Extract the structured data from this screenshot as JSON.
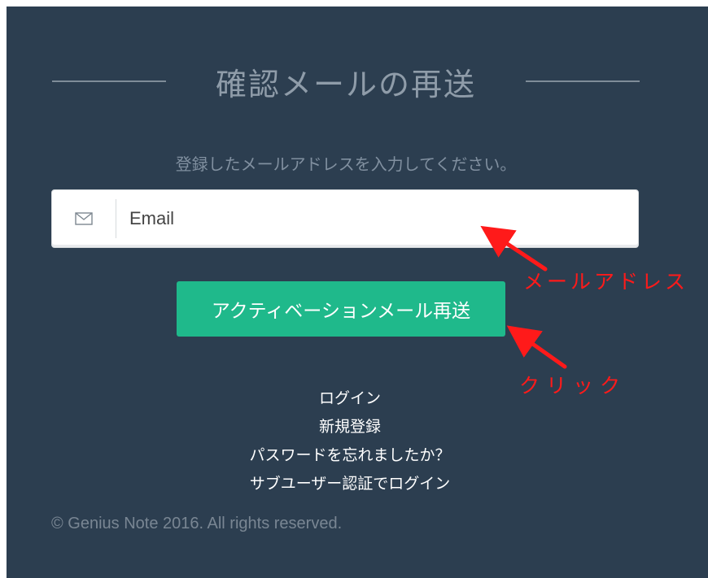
{
  "form": {
    "title": "確認メールの再送",
    "subtitle": "登録したメールアドレスを入力してください。",
    "email_placeholder": "Email",
    "email_icon": "envelope-icon",
    "submit_label": "アクティベーションメール再送"
  },
  "links": [
    {
      "label": "ログイン"
    },
    {
      "label": "新規登録"
    },
    {
      "label": "パスワードを忘れましたか？"
    },
    {
      "label": "サブユーザー認証でログイン"
    }
  ],
  "footer": {
    "copyright": "© Genius Note 2016. All rights reserved."
  },
  "annotations": {
    "email_label": "メールアドレス",
    "click_label": "クリック",
    "color": "#ff1a1a"
  },
  "colors": {
    "panel_background": "#2c3e50",
    "button_background": "#1fb98b",
    "heading_color": "#8f9ca9"
  }
}
